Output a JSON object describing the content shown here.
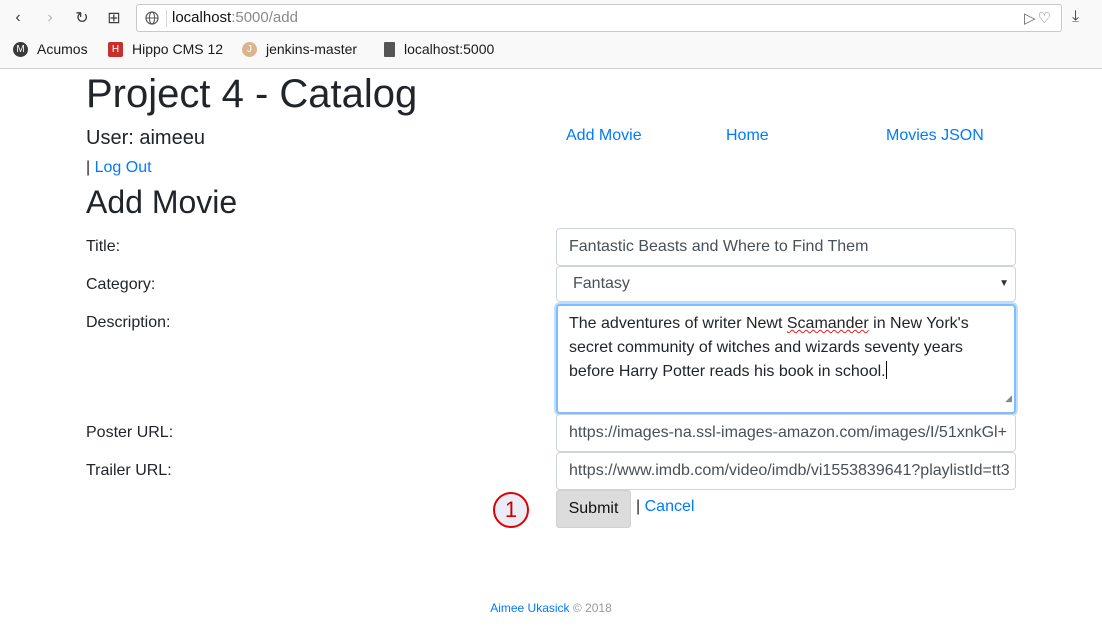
{
  "browser": {
    "url_host": "localhost",
    "url_path": ":5000/add",
    "bookmarks": [
      "Acumos",
      "Hippo CMS 12",
      "jenkins-master",
      "localhost:5000"
    ]
  },
  "header": {
    "title": "Project 4 - Catalog",
    "user": "User: aimeeu",
    "logout_sep": "|",
    "logout": "Log Out",
    "nav": [
      "Add Movie",
      "Home",
      "Movies JSON"
    ]
  },
  "form": {
    "heading": "Add Movie",
    "title_label": "Title:",
    "title_value": "Fantastic Beasts and Where to Find Them",
    "category_label": "Category:",
    "category_value": "Fantasy",
    "description_label": "Description:",
    "description_pre": "The adventures of writer Newt ",
    "description_underlined": "Scamander",
    "description_post": " in New York's secret community of witches and wizards seventy years before Harry Potter reads his book in school.",
    "poster_label": "Poster URL:",
    "poster_value": "https://images-na.ssl-images-amazon.com/images/I/51xnkGl+",
    "trailer_label": "Trailer URL:",
    "trailer_value": "https://www.imdb.com/video/imdb/vi1553839641?playlistId=tt3",
    "submit": "Submit",
    "cancel_sep": "|",
    "cancel": "Cancel"
  },
  "marker": "1",
  "footer": {
    "author": "Aimee Ukasick",
    "copyright": "© 2018"
  },
  "colors": {
    "link": "#007bff",
    "focus": "#80bdff",
    "marker": "#e00000"
  }
}
